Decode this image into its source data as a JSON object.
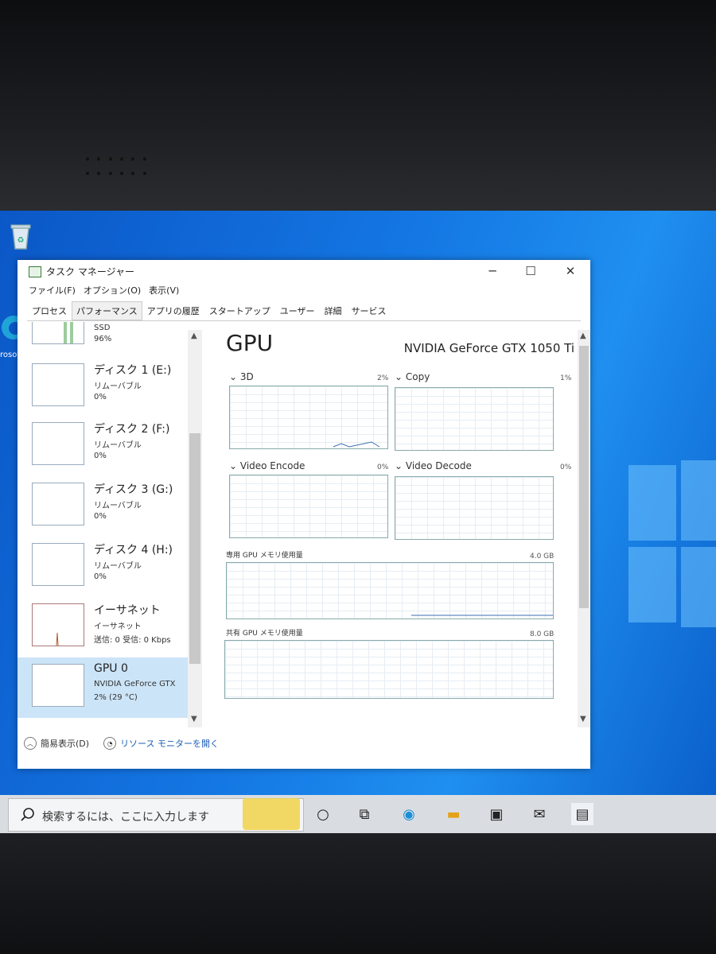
{
  "window": {
    "title": "タスク マネージャー",
    "controls": {
      "minimize": "─",
      "maximize": "☐",
      "close": "✕"
    }
  },
  "menu": [
    "ファイル(F)",
    "オプション(O)",
    "表示(V)"
  ],
  "tabs": [
    {
      "label": "プロセス",
      "active": false
    },
    {
      "label": "パフォーマンス",
      "active": true
    },
    {
      "label": "アプリの履歴",
      "active": false
    },
    {
      "label": "スタートアップ",
      "active": false
    },
    {
      "label": "ユーザー",
      "active": false
    },
    {
      "label": "詳細",
      "active": false
    },
    {
      "label": "サービス",
      "active": false
    }
  ],
  "sidebar": {
    "items": [
      {
        "name": "",
        "sub": "SSD",
        "value": "96%"
      },
      {
        "name": "ディスク 1 (E:)",
        "sub": "リムーバブル",
        "value": "0%"
      },
      {
        "name": "ディスク 2 (F:)",
        "sub": "リムーバブル",
        "value": "0%"
      },
      {
        "name": "ディスク 3 (G:)",
        "sub": "リムーバブル",
        "value": "0%"
      },
      {
        "name": "ディスク 4 (H:)",
        "sub": "リムーバブル",
        "value": "0%"
      },
      {
        "name": "イーサネット",
        "sub": "イーサネット",
        "value": "送信: 0 受信: 0 Kbps"
      },
      {
        "name": "GPU 0",
        "sub": "NVIDIA GeForce GTX",
        "value": "2% (29 °C)",
        "selected": true
      }
    ]
  },
  "main": {
    "heading": "GPU",
    "device": "NVIDIA GeForce GTX 1050 Ti",
    "engines": [
      {
        "label": "3D",
        "pct": "2%"
      },
      {
        "label": "Copy",
        "pct": "1%"
      },
      {
        "label": "Video Encode",
        "pct": "0%"
      },
      {
        "label": "Video Decode",
        "pct": "0%"
      }
    ],
    "dedicated": {
      "label": "専用 GPU メモリ使用量",
      "max": "4.0 GB"
    },
    "shared": {
      "label": "共有 GPU メモリ使用量",
      "max": "8.0 GB"
    }
  },
  "footer": {
    "fewer_details": "簡易表示(D)",
    "resource_monitor": "リソース モニターを開く"
  },
  "taskbar": {
    "search_placeholder": "検索するには、ここに入力します"
  },
  "desktop": {
    "edge_label": "rosof"
  },
  "colors": {
    "desktop": "#1477e3",
    "selection": "#cce4f7",
    "link": "#1b5db5"
  }
}
